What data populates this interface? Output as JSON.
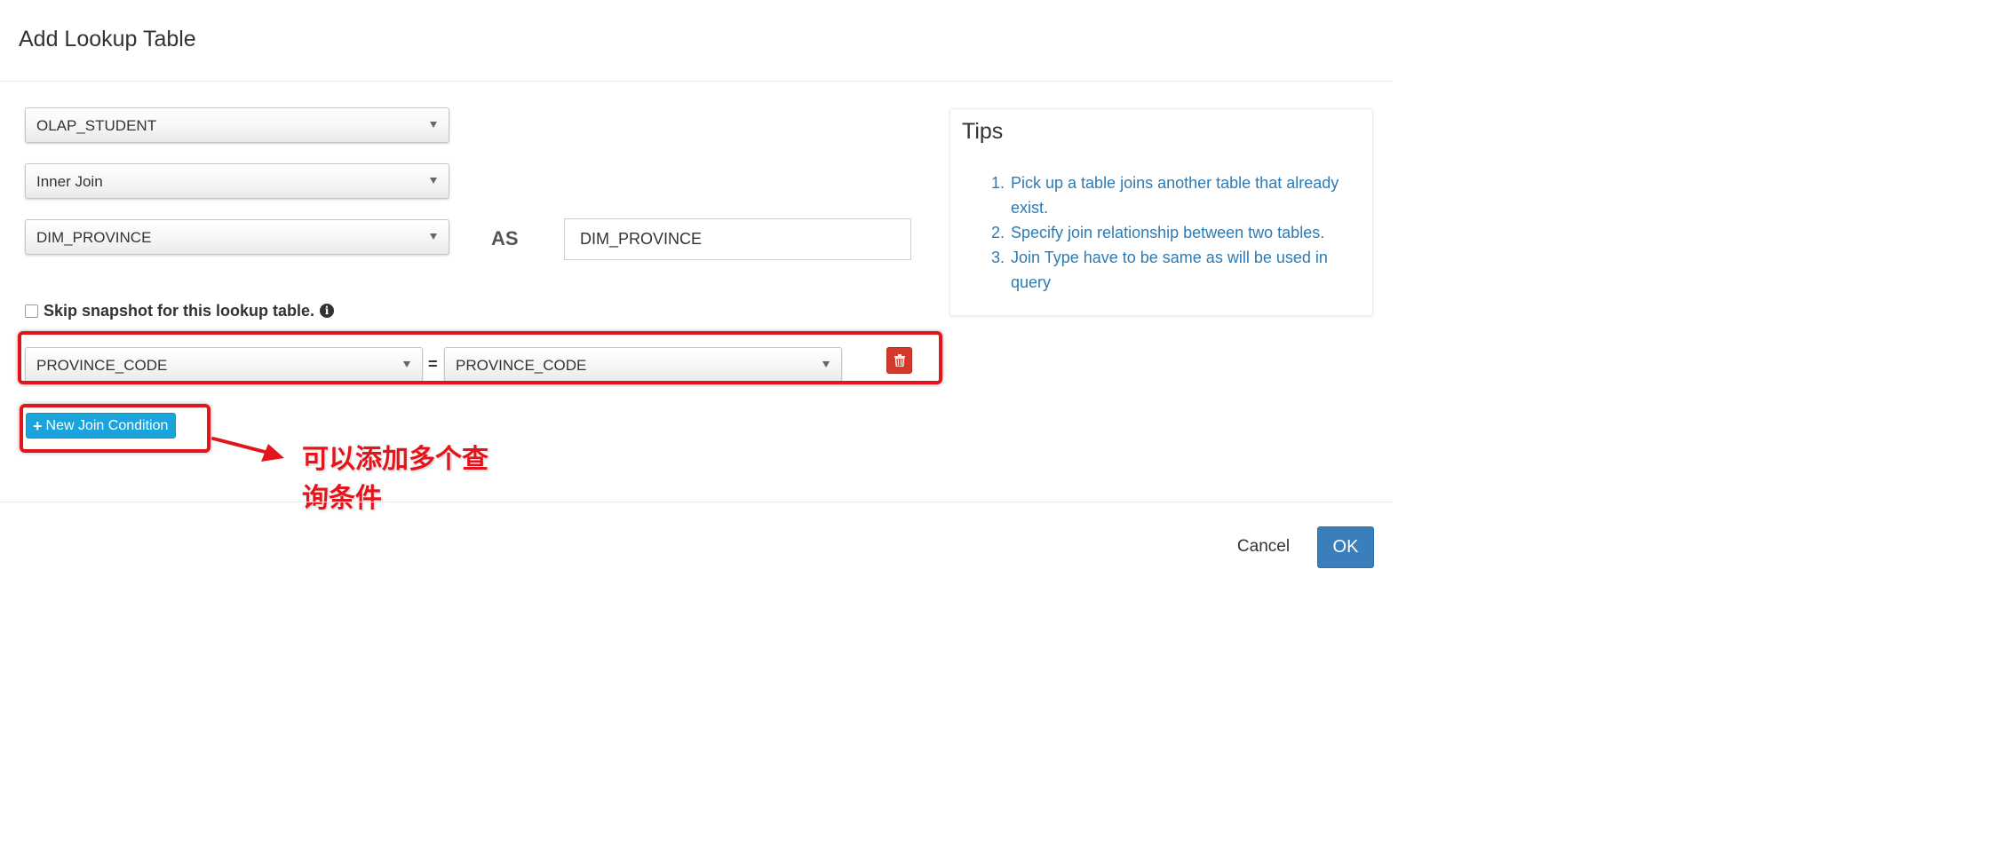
{
  "dialog": {
    "title": "Add Lookup Table"
  },
  "form": {
    "fact_table": {
      "value": "OLAP_STUDENT"
    },
    "join_type": {
      "value": "Inner Join"
    },
    "lookup_table": {
      "value": "DIM_PROVINCE"
    },
    "as_label": "AS",
    "alias": {
      "value": "DIM_PROVINCE"
    },
    "skip_snapshot_label": "Skip snapshot for this lookup table.",
    "join_condition": {
      "left_column": "PROVINCE_CODE",
      "operator": "=",
      "right_column": "PROVINCE_CODE"
    },
    "new_join_condition_label": "New Join Condition"
  },
  "annotation": {
    "text": "可以添加多个查询条件",
    "color": "#e3141a"
  },
  "tips": {
    "title": "Tips",
    "items": [
      {
        "num": "1.",
        "text": "Pick up a table joins another table that already exist."
      },
      {
        "num": "2.",
        "text": "Specify join relationship between two tables."
      },
      {
        "num": "3.",
        "text": "Join Type have to be same as will be used in query"
      }
    ],
    "color": "#2e7ab3"
  },
  "footer": {
    "cancel_label": "Cancel",
    "ok_label": "OK"
  },
  "colors": {
    "primary": "#3a7fbb",
    "info_button": "#1ba3dc",
    "danger": "#d33a2c"
  }
}
